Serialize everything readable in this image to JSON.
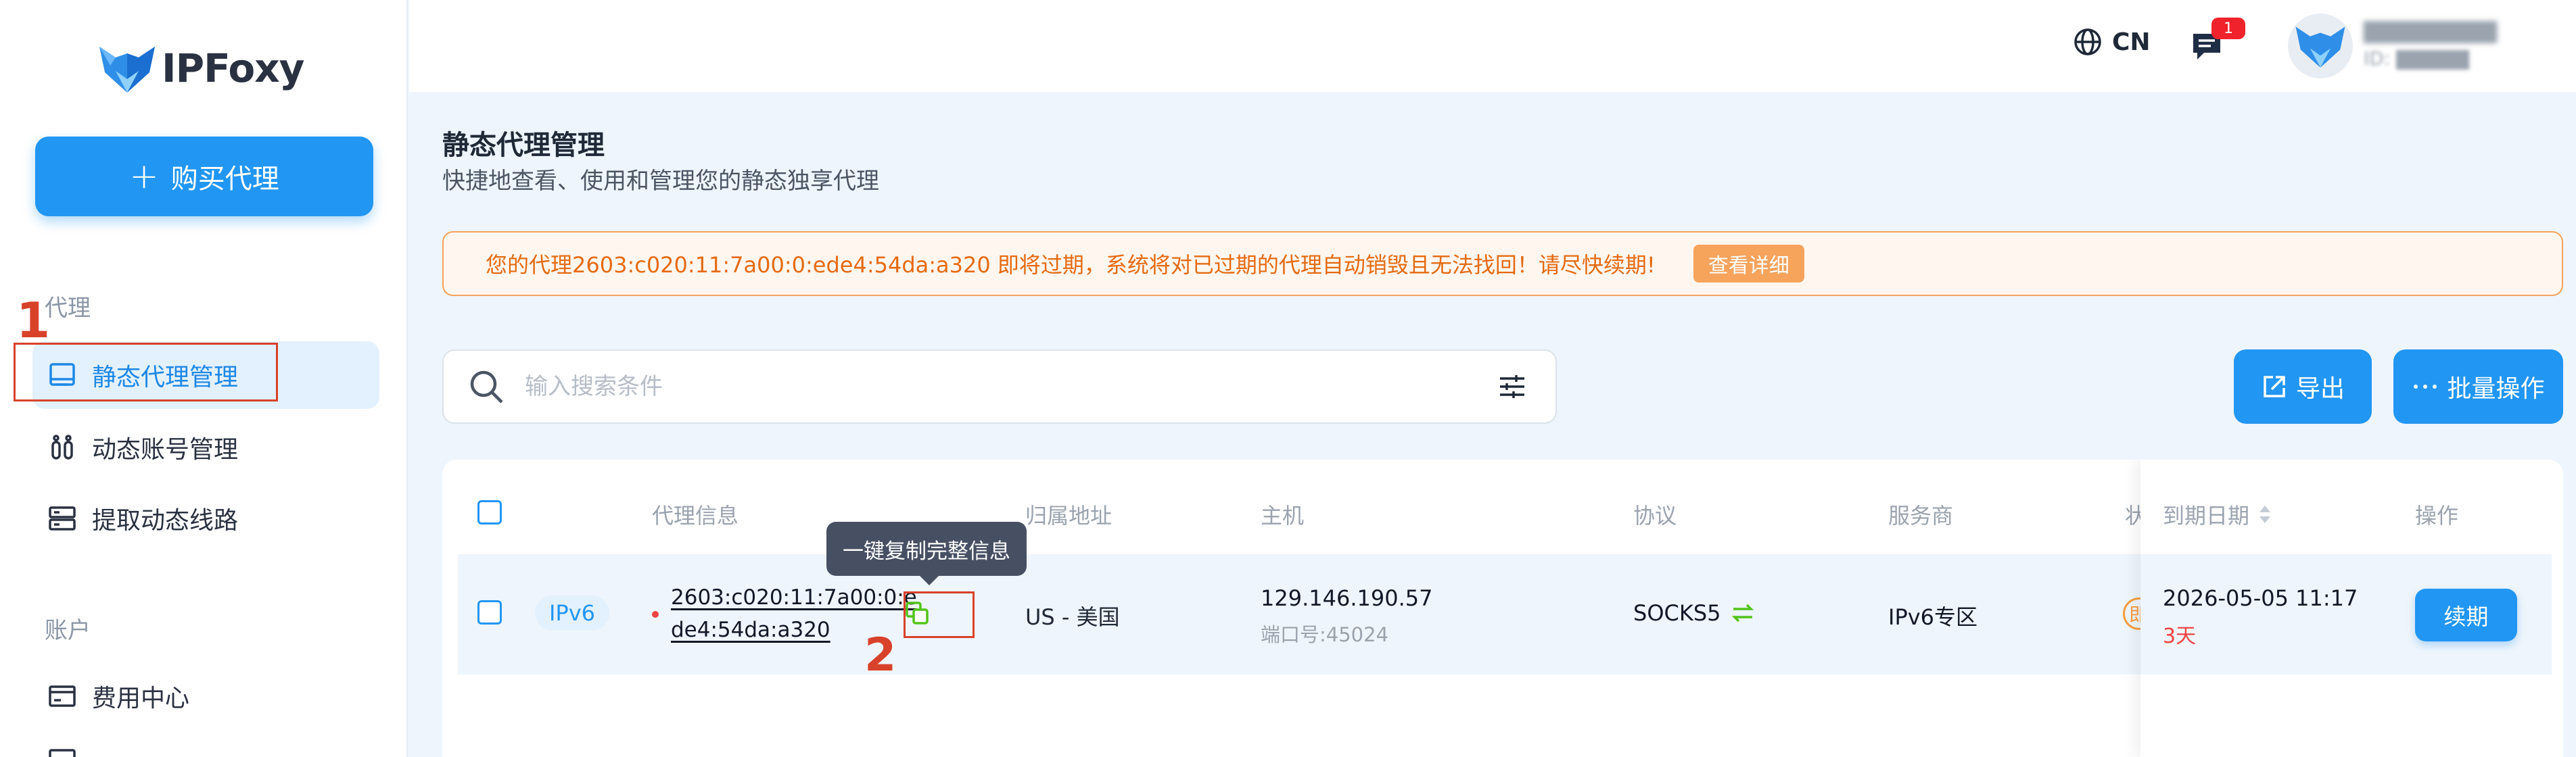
{
  "brand": {
    "name": "IPFoxy"
  },
  "sidebar": {
    "buy_button": "购买代理",
    "section_proxy": "代理",
    "section_account": "账户",
    "items": [
      {
        "label": "静态代理管理",
        "active": true
      },
      {
        "label": "动态账号管理"
      },
      {
        "label": "提取动态线路"
      },
      {
        "label": "费用中心"
      }
    ]
  },
  "header": {
    "language": "CN",
    "message_count": "1"
  },
  "page": {
    "title": "静态代理管理",
    "subtitle": "快捷地查看、使用和管理您的静态独享代理"
  },
  "alert": {
    "text": "您的代理2603:c020:11:7a00:0:ede4:54da:a320 即将过期，系统将对已过期的代理自动销毁且无法找回！请尽快续期!",
    "link": "查看详细"
  },
  "toolbar": {
    "search_placeholder": "输入搜索条件",
    "export_label": "导出",
    "bulk_label": "批量操作"
  },
  "table": {
    "headers": {
      "proxy_info": "代理信息",
      "location": "归属地址",
      "host": "主机",
      "protocol": "协议",
      "provider": "服务商",
      "status_partial": "状",
      "expire": "到期日期",
      "action": "操作"
    },
    "rows": [
      {
        "type": "IPv6",
        "proxy_line1": "2603:c020:11:7a00:0:e",
        "proxy_line2": "de4:54da:a320",
        "location": "US - 美国",
        "host_ip": "129.146.190.57",
        "host_port": "端口号:45024",
        "protocol": "SOCKS5",
        "provider": "IPv6专区",
        "status_partial": "即",
        "expire_date": "2026-05-05 11:17",
        "expire_left": "3天",
        "action": "续期"
      }
    ]
  },
  "tooltip": {
    "copy": "一键复制完整信息"
  },
  "annotations": {
    "step1": "1",
    "step2": "2"
  },
  "colors": {
    "primary": "#2196f3",
    "warning": "#f6a35c",
    "danger": "#ef4444",
    "annotation": "#d8422a",
    "success": "#52c41a"
  }
}
